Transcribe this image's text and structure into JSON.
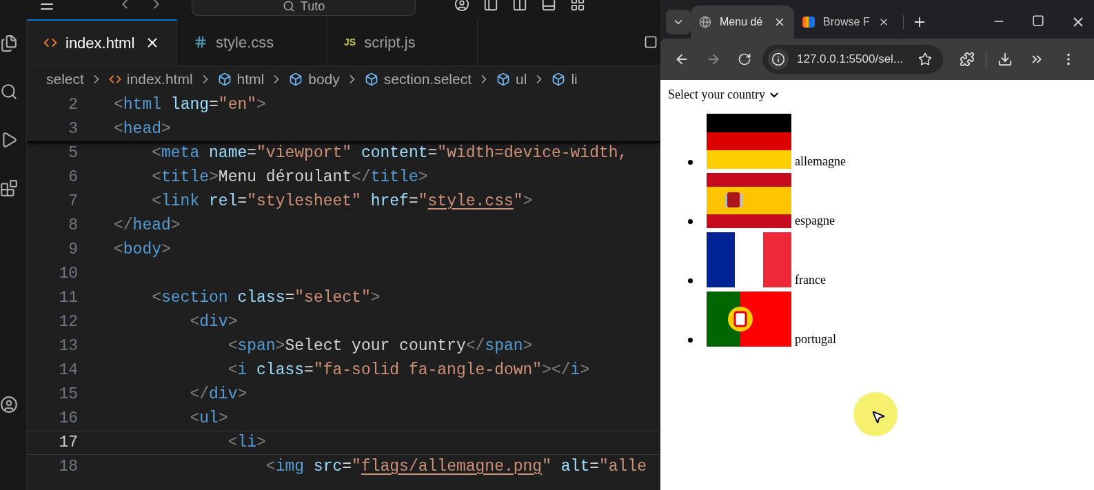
{
  "editor": {
    "command_center": {
      "value": "Tuto"
    },
    "tabs": [
      {
        "label": "index.html",
        "kind": "html",
        "selected": true
      },
      {
        "label": "style.css",
        "kind": "css",
        "selected": false
      },
      {
        "label": "script.js",
        "kind": "js",
        "icon_text": "JS",
        "selected": false
      }
    ],
    "breadcrumb": [
      {
        "label": "select",
        "kind": "folder"
      },
      {
        "label": "index.html",
        "kind": "html"
      },
      {
        "label": "html",
        "kind": "element"
      },
      {
        "label": "body",
        "kind": "element"
      },
      {
        "label": "section.select",
        "kind": "element"
      },
      {
        "label": "ul",
        "kind": "element"
      },
      {
        "label": "li",
        "kind": "element"
      }
    ],
    "sticky_lines": [
      {
        "number": "2",
        "current": false,
        "tokens": [
          {
            "kind": "punct",
            "s": "<"
          },
          {
            "kind": "tag",
            "s": "html"
          },
          {
            "kind": "attr",
            "s": " lang"
          },
          {
            "kind": "text",
            "s": "="
          },
          {
            "kind": "string",
            "s": "\"en\""
          },
          {
            "kind": "punct",
            "s": ">"
          }
        ]
      },
      {
        "number": "3",
        "current": false,
        "tokens": [
          {
            "kind": "punct",
            "s": "<"
          },
          {
            "kind": "tag",
            "s": "head"
          },
          {
            "kind": "punct",
            "s": ">"
          }
        ]
      }
    ],
    "lines": [
      {
        "number": "5",
        "current": false,
        "tokens": [
          {
            "kind": "punct",
            "s": "    <"
          },
          {
            "kind": "tag",
            "s": "meta"
          },
          {
            "kind": "attr",
            "s": " name"
          },
          {
            "kind": "text",
            "s": "="
          },
          {
            "kind": "string",
            "s": "\"viewport\""
          },
          {
            "kind": "attr",
            "s": " content"
          },
          {
            "kind": "text",
            "s": "="
          },
          {
            "kind": "string",
            "s": "\"width=device-width,"
          }
        ]
      },
      {
        "number": "6",
        "current": false,
        "tokens": [
          {
            "kind": "punct",
            "s": "    <"
          },
          {
            "kind": "tag",
            "s": "title"
          },
          {
            "kind": "punct",
            "s": ">"
          },
          {
            "kind": "text",
            "s": "Menu déroulant"
          },
          {
            "kind": "punct",
            "s": "</"
          },
          {
            "kind": "tag",
            "s": "title"
          },
          {
            "kind": "punct",
            "s": ">"
          }
        ]
      },
      {
        "number": "7",
        "current": false,
        "tokens": [
          {
            "kind": "punct",
            "s": "    <"
          },
          {
            "kind": "tag",
            "s": "link"
          },
          {
            "kind": "attr",
            "s": " rel"
          },
          {
            "kind": "text",
            "s": "="
          },
          {
            "kind": "string",
            "s": "\"stylesheet\""
          },
          {
            "kind": "attr",
            "s": " href"
          },
          {
            "kind": "text",
            "s": "="
          },
          {
            "kind": "string",
            "s": "\""
          },
          {
            "kind": "link",
            "s": "style.css"
          },
          {
            "kind": "string",
            "s": "\""
          },
          {
            "kind": "punct",
            "s": ">"
          }
        ]
      },
      {
        "number": "8",
        "current": false,
        "tokens": [
          {
            "kind": "punct",
            "s": "</"
          },
          {
            "kind": "tag",
            "s": "head"
          },
          {
            "kind": "punct",
            "s": ">"
          }
        ]
      },
      {
        "number": "9",
        "current": false,
        "tokens": [
          {
            "kind": "punct",
            "s": "<"
          },
          {
            "kind": "tag",
            "s": "body"
          },
          {
            "kind": "punct",
            "s": ">"
          }
        ]
      },
      {
        "number": "10",
        "current": false
      },
      {
        "number": "11",
        "current": false,
        "tokens": [
          {
            "kind": "punct",
            "s": "    <"
          },
          {
            "kind": "tag",
            "s": "section"
          },
          {
            "kind": "attr",
            "s": " class"
          },
          {
            "kind": "text",
            "s": "="
          },
          {
            "kind": "string",
            "s": "\"select\""
          },
          {
            "kind": "punct",
            "s": ">"
          }
        ]
      },
      {
        "number": "12",
        "current": false,
        "tokens": [
          {
            "kind": "punct",
            "s": "        <"
          },
          {
            "kind": "tag",
            "s": "div"
          },
          {
            "kind": "punct",
            "s": ">"
          }
        ]
      },
      {
        "number": "13",
        "current": false,
        "tokens": [
          {
            "kind": "punct",
            "s": "            <"
          },
          {
            "kind": "tag",
            "s": "span"
          },
          {
            "kind": "punct",
            "s": ">"
          },
          {
            "kind": "text",
            "s": "Select your country"
          },
          {
            "kind": "punct",
            "s": "</"
          },
          {
            "kind": "tag",
            "s": "span"
          },
          {
            "kind": "punct",
            "s": ">"
          }
        ]
      },
      {
        "number": "14",
        "current": false,
        "tokens": [
          {
            "kind": "punct",
            "s": "            <"
          },
          {
            "kind": "tag",
            "s": "i"
          },
          {
            "kind": "attr",
            "s": " class"
          },
          {
            "kind": "text",
            "s": "="
          },
          {
            "kind": "string",
            "s": "\"fa-solid fa-angle-down\""
          },
          {
            "kind": "punct",
            "s": "></"
          },
          {
            "kind": "tag",
            "s": "i"
          },
          {
            "kind": "punct",
            "s": ">"
          }
        ]
      },
      {
        "number": "15",
        "current": false,
        "tokens": [
          {
            "kind": "punct",
            "s": "        </"
          },
          {
            "kind": "tag",
            "s": "div"
          },
          {
            "kind": "punct",
            "s": ">"
          }
        ]
      },
      {
        "number": "16",
        "current": false,
        "tokens": [
          {
            "kind": "punct",
            "s": "        <"
          },
          {
            "kind": "tag",
            "s": "ul"
          },
          {
            "kind": "punct",
            "s": ">"
          }
        ]
      },
      {
        "number": "17",
        "current": true,
        "tokens": [
          {
            "kind": "punct",
            "s": "            <"
          },
          {
            "kind": "tag",
            "s": "li"
          },
          {
            "kind": "punct",
            "s": ">"
          }
        ]
      },
      {
        "number": "18",
        "current": false,
        "tokens": [
          {
            "kind": "punct",
            "s": "                <"
          },
          {
            "kind": "tag",
            "s": "img"
          },
          {
            "kind": "attr",
            "s": " src"
          },
          {
            "kind": "text",
            "s": "="
          },
          {
            "kind": "string",
            "s": "\""
          },
          {
            "kind": "link",
            "s": "flags/allemagne.png"
          },
          {
            "kind": "string",
            "s": "\""
          },
          {
            "kind": "attr",
            "s": " alt"
          },
          {
            "kind": "text",
            "s": "="
          },
          {
            "kind": "string",
            "s": "\"alle"
          }
        ]
      }
    ]
  },
  "browser": {
    "tabs": [
      {
        "label": "Menu dé",
        "kind": "globe",
        "selected": true
      },
      {
        "label": "Browse F",
        "kind": "app",
        "selected": false
      }
    ],
    "url": "127.0.0.1:5500/sel...",
    "page": {
      "heading": "Select your country",
      "countries": [
        {
          "name": "allemagne",
          "kind": "germany"
        },
        {
          "name": "espagne",
          "kind": "spain"
        },
        {
          "name": "france",
          "kind": "france"
        },
        {
          "name": "portugal",
          "kind": "portugal"
        }
      ]
    }
  }
}
